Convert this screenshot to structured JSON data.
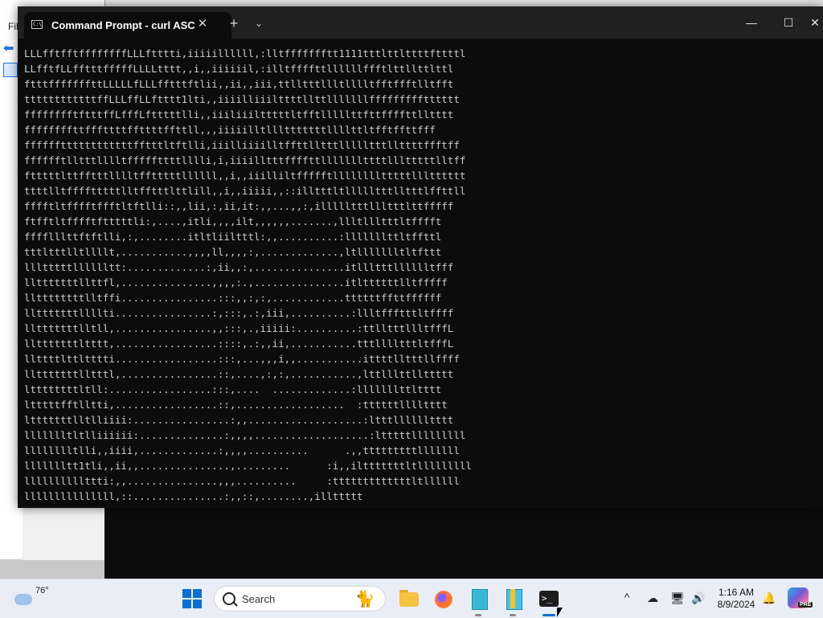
{
  "background": {
    "explorer_menu": "Fil"
  },
  "terminal": {
    "tab_title": "Command Prompt - curl  ASC",
    "tab_icon_text": "C:\\",
    "new_tab_glyph": "+",
    "dropdown_glyph": "⌄",
    "close_tab_glyph": "✕",
    "minimize_glyph": "—",
    "maximize_glyph": "☐",
    "close_glyph": "✕",
    "output_lines": [
      "LLLfftfftffffffffLLLftttti,iiiiillllll,:lltffffffftt1111tttlttlttttfttttl",
      "LLfftfLLfftttfffffLLLLtttt,,i,,iiiiiil,:illtffffttllllllffftlttllttlttl",
      "ftttfffffffttLLLLLfLLLfftttftlii,,ii,,iii,ttlltttllltlllltfftffftlltfft",
      "ttttttttttttffLLLffLLftttt1lti,,iiiilliiilttttllttlllllllffffffffftttttt",
      "fffffffftftttffLfffLftttttlli,,iiiliiiltttttltfftlllllttfttffffttlltttt",
      "ffffffffttfffttttffttttffttll,,,iiiiilltllltttttttllllttltfftffttfff",
      "ffffffttttttttttttfftttltftlli,iiilliiiilltffttlltttllllltttllttttffftff",
      "fffffftlltttlllltfffffttttlllli,i,iiiilltttffffttlllllllttttllltttttlltff",
      "ftttttlttfftttlllltfftttttllllll,,i,,iiilliltffffftlllllllltttttllltttttt",
      "ttttlltfffftttttlltfftttlttlill,,i,,iiiii,,::illtttltllllltttlltttlffttll",
      "fffftltfffftffftltftlli::,,lii,:,ii,it:,,...,,:,illllltttllltttlttfffff",
      "ftfftltfffftftttttli:,....,itli,,,,ilt,,,,,,.......,llltllltttltfffft",
      "fffflllttftftlli,:,........itltliiltttl:,,..........:lllllllttltffttl",
      "tttltttlltllllt,...........,,,,ll,,,,:,.............,ltllllllltltfttt",
      "llltttttlllllltt:.............:,ii,,:,...............itllltttlllllltfff",
      "lltttttttllttfl,...............,,,,:.,...............itlttttttlltfffff",
      "llttttttttlltffi................:::,,:,:,............ttttttffttffffff",
      "lltttttttllllti................:,:::,.:,iii,..........:llltffftttltffff",
      "lltttttttlltll,................,,:::,.,iiiii:..........:ttlltttllltfffL",
      "lltttttttltttt,.................::::,.:,,ii,...........tttlllltttltfffL",
      "llttttlttltttti.................:::,...,,,i,,...........ittttlltttllffff",
      "lltttttttlltttl,................::,....,:,:,...........,lttlllttllttttt",
      "lttttttttltll:.................:::,....  .............:lllllllttltttt",
      "ltttttfftlltti,.................::,..................  :ttttttlllltttt",
      "ltttttttlltlliiii:................:,,...................:ltttlllllltttt",
      "llllllltltlliiiiii:..............:,,,,...................:ltttttlllllllll",
      "lllllllltlli,,iiii,.............:,,,,..........      .,,tttttttttlllllll",
      "llllllltt1tli,,ii,,...............,.........      :i,,iltttttttltlllllllll",
      "llllllllllttti:,,...............,,,..........     :tttttttttttttltllllll",
      "lllllllllllllll,::...............:,,::,........,illttttt"
    ]
  },
  "taskbar": {
    "temperature": "76°",
    "search_label": "Search",
    "search_decor": "🐈",
    "terminal_glyph": ">_",
    "tray_chevron": "^",
    "tray_onedrive": "☁",
    "tray_network": "🖥",
    "tray_sound": "🔊",
    "clock_time": "1:16 AM",
    "clock_date": "8/9/2024",
    "bell": "🔔",
    "copilot_badge": "PRE"
  }
}
